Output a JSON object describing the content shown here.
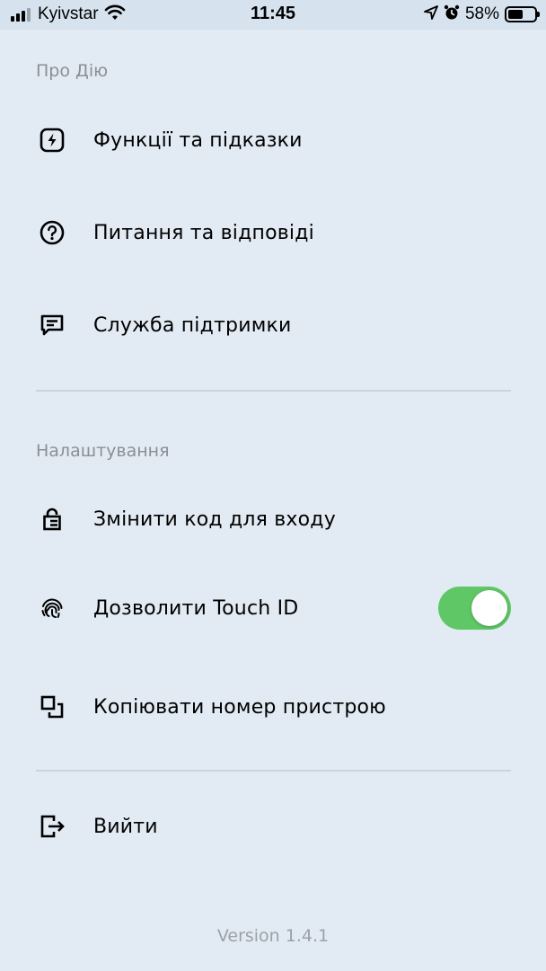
{
  "status_bar": {
    "carrier": "Kyivstar",
    "time": "11:45",
    "battery": "58%",
    "battery_level": 0.58
  },
  "sections": {
    "about_title": "Про Дію",
    "settings_title": "Налаштування"
  },
  "menu": {
    "features": "Функції та підказки",
    "faq": "Питання та відповіді",
    "support": "Служба підтримки",
    "change_code": "Змінити код для входу",
    "touch_id": "Дозволити Touch ID",
    "copy_device": "Копіювати номер пристрою",
    "logout": "Вийти"
  },
  "touch_id_enabled": true,
  "accent": {
    "toggle_on": "#5fc766",
    "background": "#e2ebf4"
  },
  "icons": [
    "flash-icon",
    "question-icon",
    "chat-icon",
    "lock-icon",
    "fingerprint-icon",
    "copy-icon",
    "logout-icon"
  ],
  "version": "Version 1.4.1"
}
